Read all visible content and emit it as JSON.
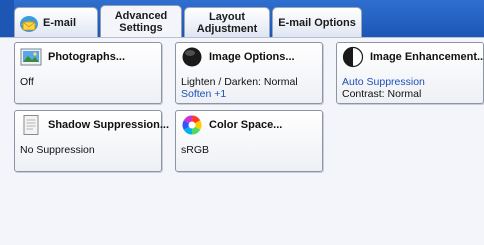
{
  "tabs": [
    {
      "label": "E-mail",
      "icon": "email-icon",
      "active": false
    },
    {
      "label": "Advanced\nSettings",
      "active": true
    },
    {
      "label": "Layout\nAdjustment",
      "active": false
    },
    {
      "label": "E-mail Options",
      "active": false
    }
  ],
  "cards": {
    "photographs": {
      "title": "Photographs...",
      "icon": "photograph-icon",
      "line1": "Off",
      "line2": ""
    },
    "image_options": {
      "title": "Image Options...",
      "icon": "image-options-icon",
      "line1": "Lighten / Darken: Normal",
      "line2": "Soften +1"
    },
    "image_enhancement": {
      "title": "Image Enhancement...",
      "icon": "image-enhancement-icon",
      "line1": "Auto Suppression",
      "line2": "Contrast: Normal"
    },
    "shadow_suppression": {
      "title": "Shadow Suppression...",
      "icon": "shadow-suppression-icon",
      "line1": "No Suppression",
      "line2": ""
    },
    "color_space": {
      "title": "Color Space...",
      "icon": "color-space-icon",
      "line1": "sRGB",
      "line2": ""
    }
  },
  "colors": {
    "tab_bar": "#1d56b4",
    "value_blue": "#1d4fb8"
  }
}
